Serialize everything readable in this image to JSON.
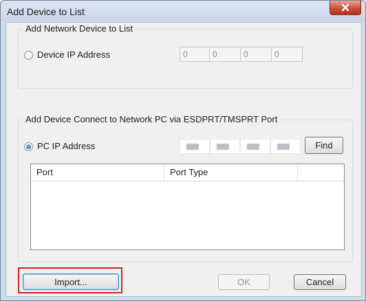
{
  "window": {
    "title": "Add Device to List",
    "close_icon": "close-x-icon"
  },
  "network_group": {
    "label": "Add Network Device to List",
    "radio_label": "Device IP Address",
    "radio_selected": false,
    "ip_segments": [
      "0",
      "0",
      "0",
      "0"
    ]
  },
  "pc_group": {
    "label": "Add Device Connect to Network PC via ESDPRT/TMSPRT Port",
    "radio_label": "PC IP Address",
    "radio_selected": true,
    "find_label": "Find",
    "table": {
      "columns": [
        "Port",
        "Port Type"
      ]
    }
  },
  "footer": {
    "import_label": "Import...",
    "ok_label": "OK",
    "cancel_label": "Cancel",
    "highlight_color": "#d4202a"
  }
}
